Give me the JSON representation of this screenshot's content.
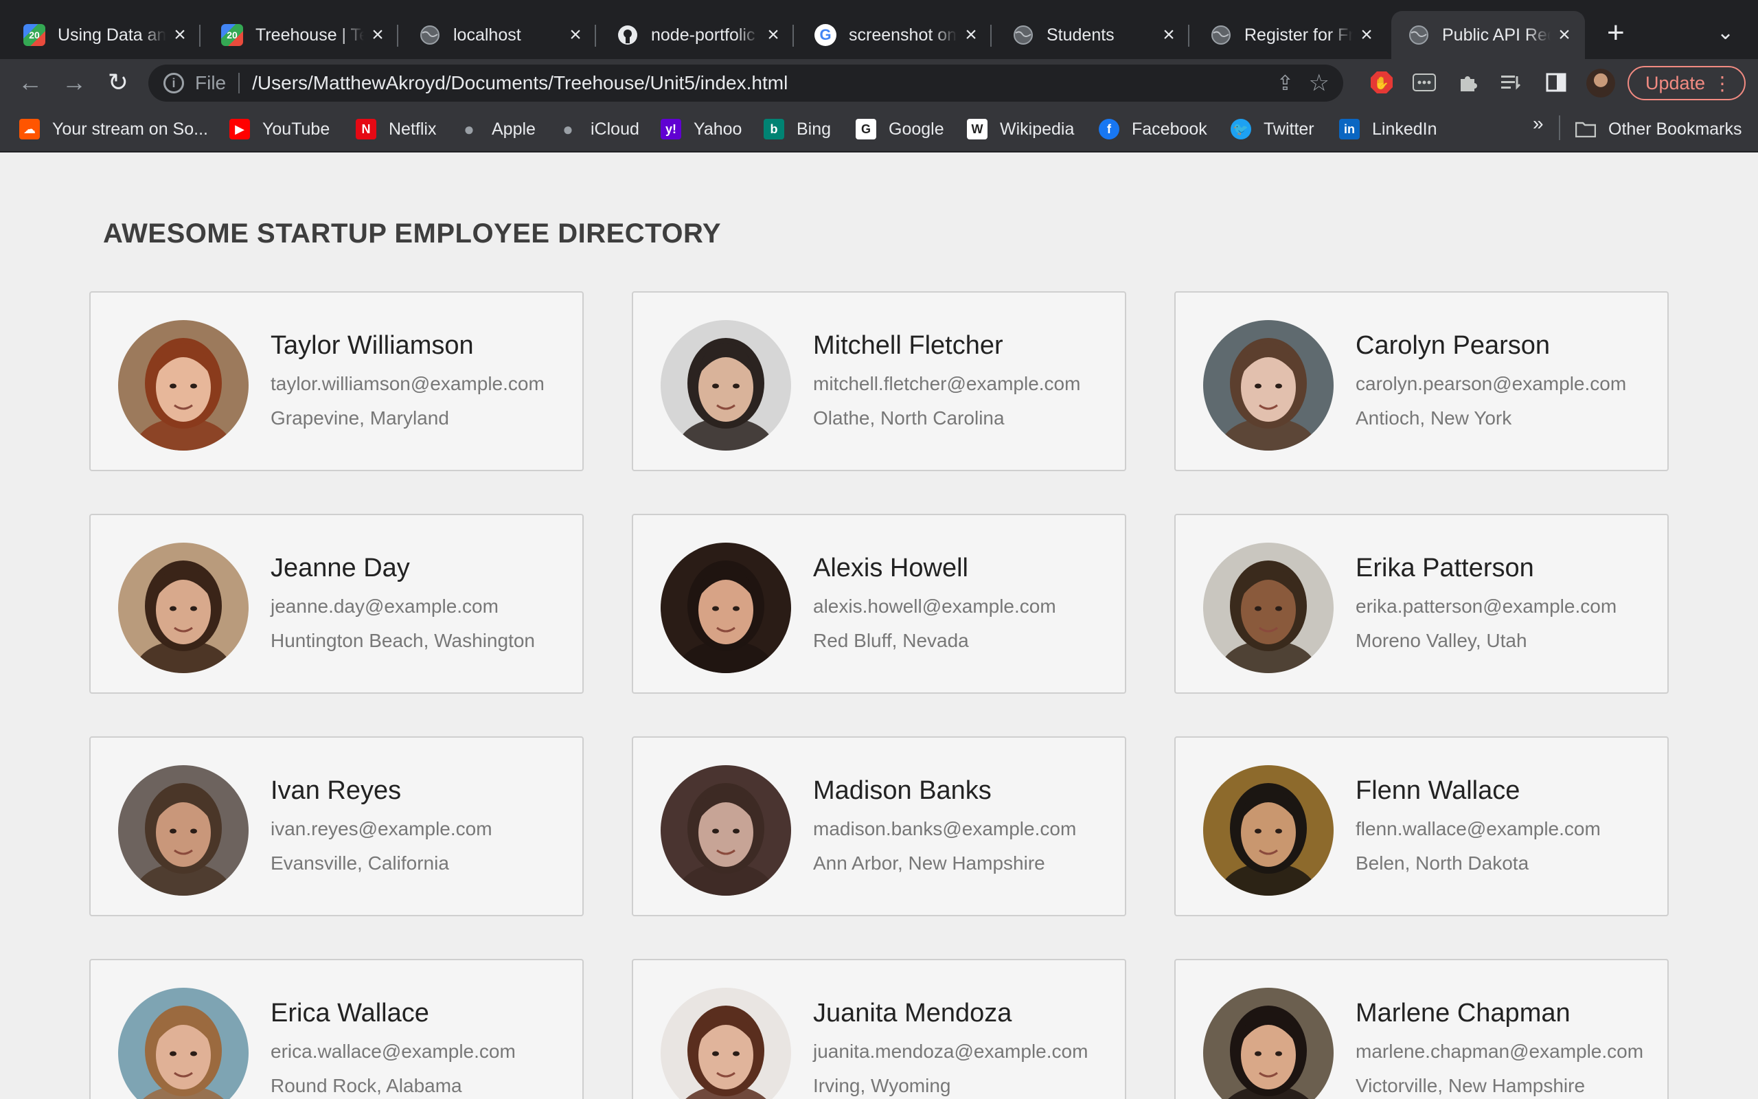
{
  "tabs": [
    {
      "title": "Using Data an",
      "favicon": "20",
      "color": "#e94b3c"
    },
    {
      "title": "Treehouse | Te",
      "favicon": "20",
      "color": "#e94b3c"
    },
    {
      "title": "localhost",
      "favicon": "globe",
      "color": "#5f6368"
    },
    {
      "title": "node-portfolic",
      "favicon": "github",
      "color": "#e8eaed"
    },
    {
      "title": "screenshot on",
      "favicon": "G",
      "color": "#ffffff"
    },
    {
      "title": "Students",
      "favicon": "globe",
      "color": "#5f6368"
    },
    {
      "title": "Register for Fr",
      "favicon": "globe",
      "color": "#5f6368"
    },
    {
      "title": "Public API Req",
      "favicon": "globe",
      "color": "#5f6368",
      "active": true
    }
  ],
  "toolbar": {
    "file_label": "File",
    "url": "/Users/MatthewAkroyd/Documents/Treehouse/Unit5/index.html",
    "update_label": "Update"
  },
  "bookmarks": [
    {
      "label": "Your stream on So...",
      "icon": "soundcloud-icon",
      "color": "#ff5500"
    },
    {
      "label": "YouTube",
      "icon": "youtube-icon",
      "color": "#ff0000"
    },
    {
      "label": "Netflix",
      "icon": "netflix-icon",
      "color": "#e50914"
    },
    {
      "label": "Apple",
      "icon": "apple-icon",
      "color": "#9aa0a6"
    },
    {
      "label": "iCloud",
      "icon": "apple-icon",
      "color": "#9aa0a6"
    },
    {
      "label": "Yahoo",
      "icon": "yahoo-icon",
      "color": "#6001d2"
    },
    {
      "label": "Bing",
      "icon": "bing-icon",
      "color": "#008373"
    },
    {
      "label": "Google",
      "icon": "google-icon",
      "color": "#ffffff"
    },
    {
      "label": "Wikipedia",
      "icon": "wikipedia-icon",
      "color": "#ffffff"
    },
    {
      "label": "Facebook",
      "icon": "facebook-icon",
      "color": "#1877f2"
    },
    {
      "label": "Twitter",
      "icon": "twitter-icon",
      "color": "#1da1f2"
    },
    {
      "label": "LinkedIn",
      "icon": "linkedin-icon",
      "color": "#0a66c2"
    }
  ],
  "other_bookmarks": "Other Bookmarks",
  "page": {
    "title": "AWESOME STARTUP EMPLOYEE DIRECTORY"
  },
  "employees": [
    {
      "name": "Taylor Williamson",
      "email": "taylor.williamson@example.com",
      "location": "Grapevine, Maryland",
      "skin": "#e7b79a",
      "hair": "#8a3b1c",
      "bg": "#9c7a5c"
    },
    {
      "name": "Mitchell Fletcher",
      "email": "mitchell.fletcher@example.com",
      "location": "Olathe, North Carolina",
      "skin": "#d9b39a",
      "hair": "#2b2320",
      "bg": "#d6d6d6"
    },
    {
      "name": "Carolyn Pearson",
      "email": "carolyn.pearson@example.com",
      "location": "Antioch, New York",
      "skin": "#e2c0ae",
      "hair": "#5c3f2e",
      "bg": "#5f6a6f"
    },
    {
      "name": "Jeanne Day",
      "email": "jeanne.day@example.com",
      "location": "Huntington Beach, Washington",
      "skin": "#d8a98c",
      "hair": "#3a2418",
      "bg": "#b99b7c"
    },
    {
      "name": "Alexis Howell",
      "email": "alexis.howell@example.com",
      "location": "Red Bluff, Nevada",
      "skin": "#d7a386",
      "hair": "#1f1410",
      "bg": "#2a1c16"
    },
    {
      "name": "Erika Patterson",
      "email": "erika.patterson@example.com",
      "location": "Moreno Valley, Utah",
      "skin": "#8a5a3c",
      "hair": "#3a2a1c",
      "bg": "#c9c6bf"
    },
    {
      "name": "Ivan Reyes",
      "email": "ivan.reyes@example.com",
      "location": "Evansville, California",
      "skin": "#c9977a",
      "hair": "#4a3628",
      "bg": "#6d635e"
    },
    {
      "name": "Madison Banks",
      "email": "madison.banks@example.com",
      "location": "Ann Arbor, New Hampshire",
      "skin": "#c7a496",
      "hair": "#3d2a24",
      "bg": "#4a3430"
    },
    {
      "name": "Flenn Wallace",
      "email": "flenn.wallace@example.com",
      "location": "Belen, North Dakota",
      "skin": "#c9976f",
      "hair": "#1b1612",
      "bg": "#8d6a2c"
    },
    {
      "name": "Erica Wallace",
      "email": "erica.wallace@example.com",
      "location": "Round Rock, Alabama",
      "skin": "#e0b196",
      "hair": "#9b6a3f",
      "bg": "#7ea4b3"
    },
    {
      "name": "Juanita Mendoza",
      "email": "juanita.mendoza@example.com",
      "location": "Irving, Wyoming",
      "skin": "#e0b49b",
      "hair": "#5a2e1e",
      "bg": "#e9e5e2"
    },
    {
      "name": "Marlene Chapman",
      "email": "marlene.chapman@example.com",
      "location": "Victorville, New Hampshire",
      "skin": "#d9a888",
      "hair": "#1c1411",
      "bg": "#6b5f4f"
    }
  ]
}
